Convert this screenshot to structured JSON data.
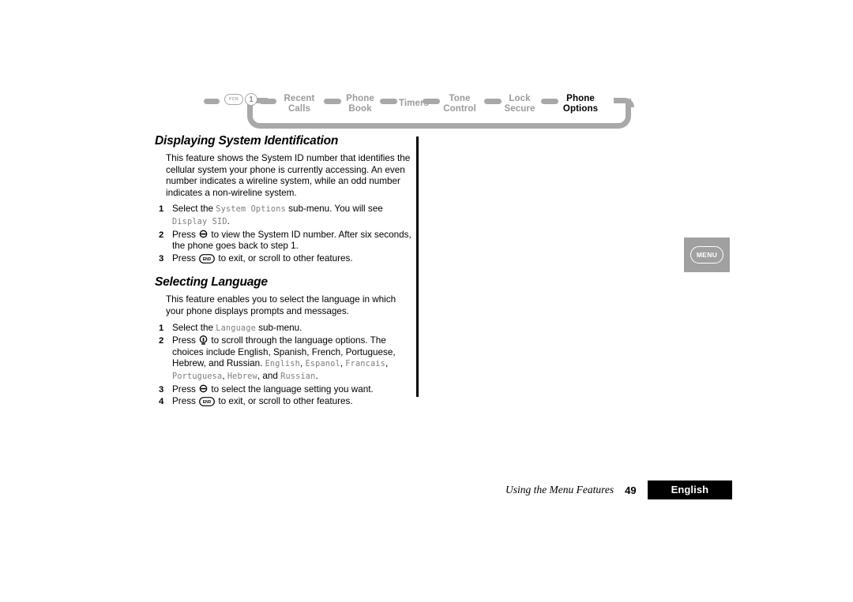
{
  "breadcrumb": {
    "start_keys": {
      "fcn_label": "FCN",
      "number_label": "1"
    },
    "items": [
      {
        "label": "Recent\nCalls",
        "active": false
      },
      {
        "label": "Phone\nBook",
        "active": false
      },
      {
        "label": "Timers",
        "active": false
      },
      {
        "label": "Tone\nControl",
        "active": false
      },
      {
        "label": "Lock\nSecure",
        "active": false
      },
      {
        "label": "Phone\nOptions",
        "active": true
      }
    ],
    "colors": {
      "inactive": "#9a9a9a",
      "active": "#000000",
      "track": "#a8a8a8"
    }
  },
  "sections": [
    {
      "title": "Displaying System Identification",
      "intro": "This feature shows the System ID number that identifies the cellular system your phone is currently accessing. An even number indicates a wireline system, while an odd number indicates a non-wireline system.",
      "steps": [
        {
          "num": "1",
          "parts": [
            {
              "t": "Select the ",
              "style": "normal"
            },
            {
              "t": "System Options",
              "style": "lcd"
            },
            {
              "t": " sub-menu. You will see ",
              "style": "normal"
            },
            {
              "t": "Display SID",
              "style": "lcd"
            },
            {
              "t": ".",
              "style": "normal"
            }
          ]
        },
        {
          "num": "2",
          "parts": [
            {
              "t": "Press ",
              "style": "normal"
            },
            {
              "t": "select-key",
              "style": "icon"
            },
            {
              "t": " to view the System ID number. After six seconds, the phone goes back to step 1.",
              "style": "normal"
            }
          ]
        },
        {
          "num": "3",
          "parts": [
            {
              "t": "Press ",
              "style": "normal"
            },
            {
              "t": "end-key",
              "style": "icon"
            },
            {
              "t": " to exit, or scroll to other features.",
              "style": "normal"
            }
          ]
        }
      ]
    },
    {
      "title": "Selecting Language",
      "intro": "This feature enables you to select the language in which your phone displays prompts and messages.",
      "steps": [
        {
          "num": "1",
          "parts": [
            {
              "t": "Select the ",
              "style": "normal"
            },
            {
              "t": "Language",
              "style": "lcd"
            },
            {
              "t": " sub-menu.",
              "style": "normal"
            }
          ]
        },
        {
          "num": "2",
          "parts": [
            {
              "t": "Press ",
              "style": "normal"
            },
            {
              "t": "scroll-key",
              "style": "icon"
            },
            {
              "t": " to scroll through the language options. The choices include English, Spanish, French, Portuguese, Hebrew, and Russian. ",
              "style": "normal"
            },
            {
              "t": "English",
              "style": "lcd"
            },
            {
              "t": ", ",
              "style": "normal"
            },
            {
              "t": "Espanol",
              "style": "lcd"
            },
            {
              "t": ", ",
              "style": "normal"
            },
            {
              "t": "Francais",
              "style": "lcd"
            },
            {
              "t": ", ",
              "style": "normal"
            },
            {
              "t": "Portuguesa",
              "style": "lcd"
            },
            {
              "t": ", ",
              "style": "normal"
            },
            {
              "t": "Hebrew",
              "style": "lcd"
            },
            {
              "t": ", and ",
              "style": "normal"
            },
            {
              "t": "Russian",
              "style": "lcd"
            },
            {
              "t": ".",
              "style": "normal"
            }
          ]
        },
        {
          "num": "3",
          "parts": [
            {
              "t": "Press ",
              "style": "normal"
            },
            {
              "t": "select-key",
              "style": "icon"
            },
            {
              "t": " to select the language setting you want.",
              "style": "normal"
            }
          ]
        },
        {
          "num": "4",
          "parts": [
            {
              "t": "Press ",
              "style": "normal"
            },
            {
              "t": "end-key",
              "style": "icon"
            },
            {
              "t": " to exit, or scroll to other features.",
              "style": "normal"
            }
          ]
        }
      ]
    }
  ],
  "menu_tab": {
    "label": "MENU"
  },
  "footer": {
    "chapter": "Using the Menu Features",
    "page_number": "49",
    "language": "English"
  },
  "keys": {
    "end_label": "END"
  }
}
